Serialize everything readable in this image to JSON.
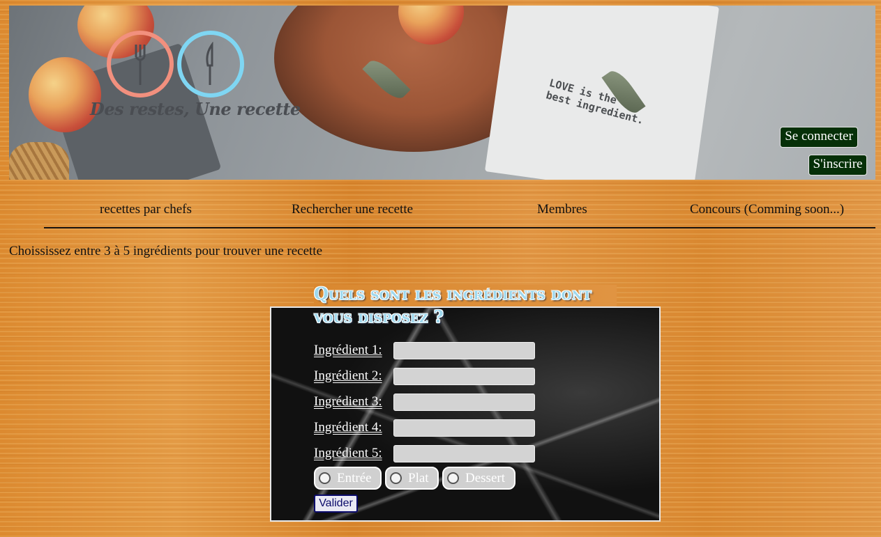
{
  "banner": {
    "logo_text": "Des restes, Une recette",
    "napkin_text_line1": "LOVE is the",
    "napkin_text_line2": "best ingredient."
  },
  "auth": {
    "login_label": "Se connecter",
    "signup_label": "S'inscrire"
  },
  "nav": {
    "items": [
      {
        "label": "recettes par chefs"
      },
      {
        "label": "Rechercher une recette"
      },
      {
        "label": "Membres"
      },
      {
        "label": "Concours (Comming soon...)"
      }
    ]
  },
  "intro_text": "Choississez entre 3 à 5 ingrédients pour trouver une recette",
  "form": {
    "title": "Quels sont les ingrédients dont vous disposez ?",
    "fields": [
      {
        "label": "Ingrédient 1:",
        "value": ""
      },
      {
        "label": "Ingrédient 2:",
        "value": ""
      },
      {
        "label": "Ingrédient 3:",
        "value": ""
      },
      {
        "label": "Ingrédient 4:",
        "value": ""
      },
      {
        "label": "Ingrédient 5:",
        "value": ""
      }
    ],
    "categories": [
      {
        "label": "Entrée"
      },
      {
        "label": "Plat"
      },
      {
        "label": "Dessert"
      }
    ],
    "submit_label": "Valider"
  },
  "colors": {
    "auth_button_bg": "#063008",
    "title_color": "#9ed8ee",
    "fork_ring": "#f2907e",
    "knife_ring": "#7fd6f3"
  }
}
